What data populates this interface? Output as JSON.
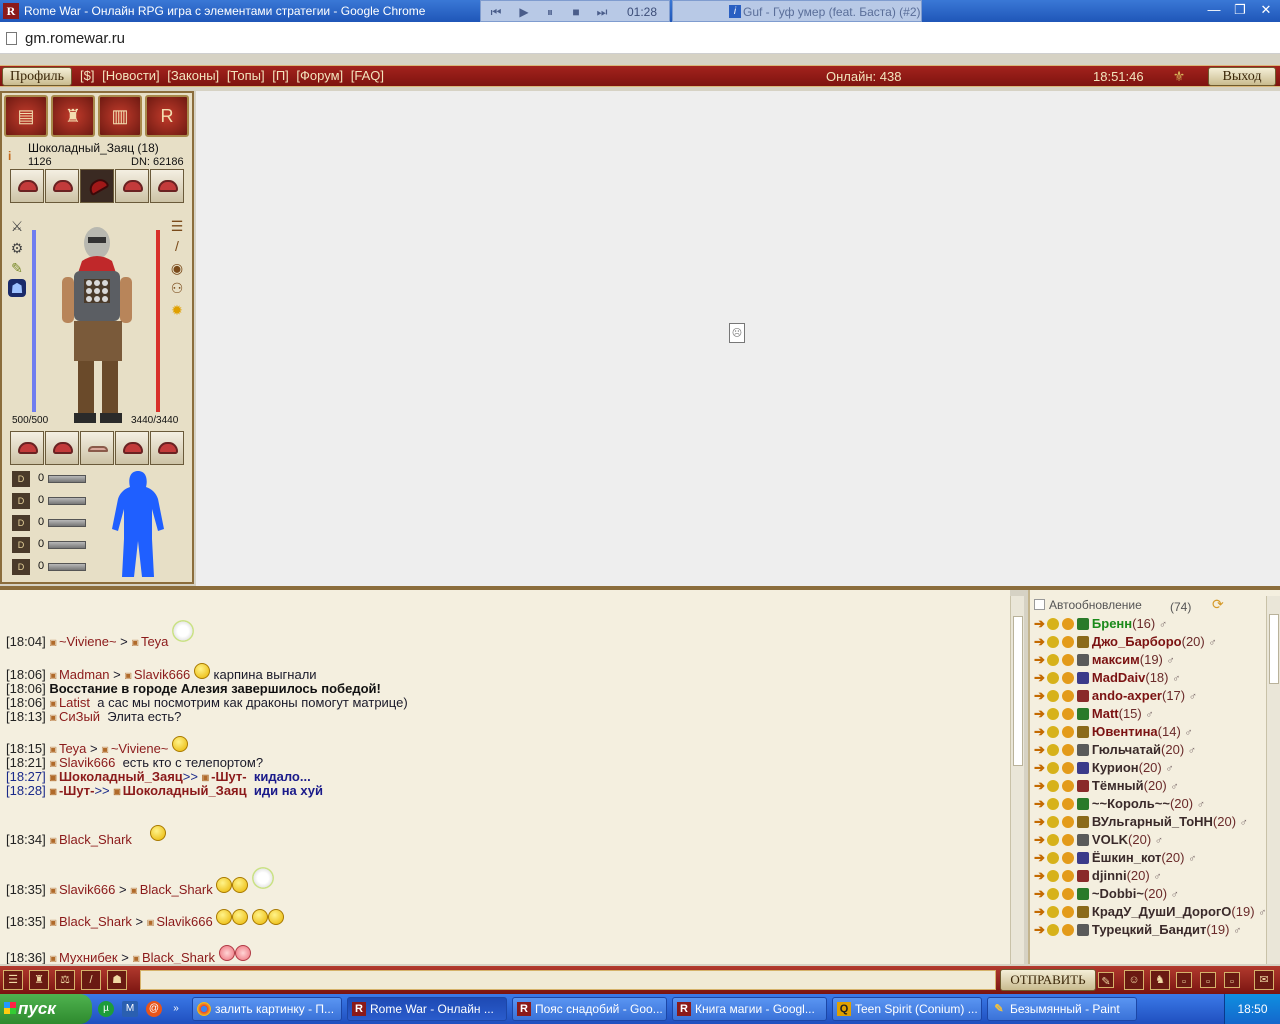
{
  "window": {
    "title": "Rome War - Онлайн RPG игра с элементами стратегии - Google Chrome",
    "url": "gm.romewar.ru"
  },
  "media_player": {
    "time": "01:28",
    "track": "Guf - Гуф умер (feat. Баста) (#2)"
  },
  "topnav": {
    "profile_label": "Профиль",
    "links": [
      "[$]",
      "[Новости]",
      "[Законы]",
      "[Топы]",
      "[П]",
      "[Форум]",
      "[FAQ]"
    ],
    "online_label": "Онлайн: 438",
    "clock": "18:51:46",
    "exit_label": "Выход"
  },
  "character": {
    "name": "Шоколадный_Заяц (18)",
    "level_value": "1126",
    "dn": "DN: 62186",
    "hp": "500/500",
    "mp": "3440/3440",
    "stats": [
      "0",
      "0",
      "0",
      "0",
      "0"
    ]
  },
  "chat": {
    "messages": [
      {
        "time": "[18:04]",
        "from": "~Viviene~",
        "to": "Teya",
        "text": ""
      },
      {
        "time": "[18:06]",
        "from": "Madman",
        "to": "Slavik666",
        "text": "карпина выгнали"
      },
      {
        "time": "[18:06]",
        "bold": "Восстание в городе Алезия завершилось победой!"
      },
      {
        "time": "[18:06]",
        "from": "Latist",
        "text": "а сас мы посмотрим как драконы помогут матрице)"
      },
      {
        "time": "[18:13]",
        "from": "СиЗый",
        "text": "Элита есть?"
      },
      {
        "time": "[18:15]",
        "from": "Teya",
        "to": "~Viviene~",
        "text": ""
      },
      {
        "time": "[18:21]",
        "from": "Slavik666",
        "text": "есть кто с телепортом?"
      },
      {
        "time": "[18:27]",
        "from": "Шоколадный_Заяц",
        "private_to": "-Шут-",
        "text": "кидало..."
      },
      {
        "time": "[18:28]",
        "from": "-Шут-",
        "private_to": "Шоколадный_Заяц",
        "text": "иди на хуй"
      },
      {
        "time": "[18:34]",
        "from": "Black_Shark",
        "text": ""
      },
      {
        "time": "[18:35]",
        "from": "Slavik666",
        "to": "Black_Shark",
        "text": ""
      },
      {
        "time": "[18:35]",
        "from": "Black_Shark",
        "to": "Slavik666",
        "text": ""
      },
      {
        "time": "[18:36]",
        "from": "Мухнибек",
        "to": "Black_Shark",
        "text": ""
      }
    ],
    "input_value": "",
    "send_label": "ОТПРАВИТЬ"
  },
  "users": {
    "auto_refresh_label": "Автообновление",
    "count": "(74)",
    "list": [
      {
        "name": "Бренн",
        "level": "(16)",
        "color": "#1a8a1a"
      },
      {
        "name": "Джо_Барборо",
        "level": "(20)",
        "color": "#7b1212"
      },
      {
        "name": "максим",
        "level": "(19)",
        "color": "#7b1212"
      },
      {
        "name": "MadDaiv",
        "level": "(18)",
        "color": "#7b1212"
      },
      {
        "name": "ando-axper",
        "level": "(17)",
        "color": "#7b1212"
      },
      {
        "name": "Matt",
        "level": "(15)",
        "color": "#7b1212"
      },
      {
        "name": "Ювентина",
        "level": "(14)",
        "color": "#7b1212"
      },
      {
        "name": "Гюльчатай",
        "level": "(20)",
        "color": "#3a2a2a"
      },
      {
        "name": "Курион",
        "level": "(20)",
        "color": "#3a2a2a"
      },
      {
        "name": "Тёмный",
        "level": "(20)",
        "color": "#3a2a2a"
      },
      {
        "name": "~~Король~~",
        "level": "(20)",
        "color": "#3a2a2a"
      },
      {
        "name": "ВУльгарный_ТоНН",
        "level": "(20)",
        "color": "#3a2a2a"
      },
      {
        "name": "VOLK",
        "level": "(20)",
        "color": "#3a2a2a"
      },
      {
        "name": "Ёшкин_кот",
        "level": "(20)",
        "color": "#3a2a2a"
      },
      {
        "name": "djinni",
        "level": "(20)",
        "color": "#3a2a2a"
      },
      {
        "name": "~Dobbi~",
        "level": "(20)",
        "color": "#3a2a2a"
      },
      {
        "name": "КрадУ_ДушИ_ДорогО",
        "level": "(19)",
        "color": "#3a2a2a"
      },
      {
        "name": "Турецкий_Бандит",
        "level": "(19)",
        "color": "#3a2a2a"
      }
    ]
  },
  "taskbar": {
    "start_label": "пуск",
    "tasks": [
      {
        "label": "залить картинку - П...",
        "icon": "chrome-icon"
      },
      {
        "label": "Rome War - Онлайн ...",
        "icon": "romewar-icon"
      },
      {
        "label": "Пояс снадобий - Goo...",
        "icon": "romewar-icon"
      },
      {
        "label": "Книга магии - Googl...",
        "icon": "romewar-icon"
      },
      {
        "label": "Teen Spirit (Conium) ...",
        "icon": "player-icon"
      },
      {
        "label": "Безымянный - Paint",
        "icon": "paint-icon"
      }
    ],
    "clock": "18:50"
  }
}
